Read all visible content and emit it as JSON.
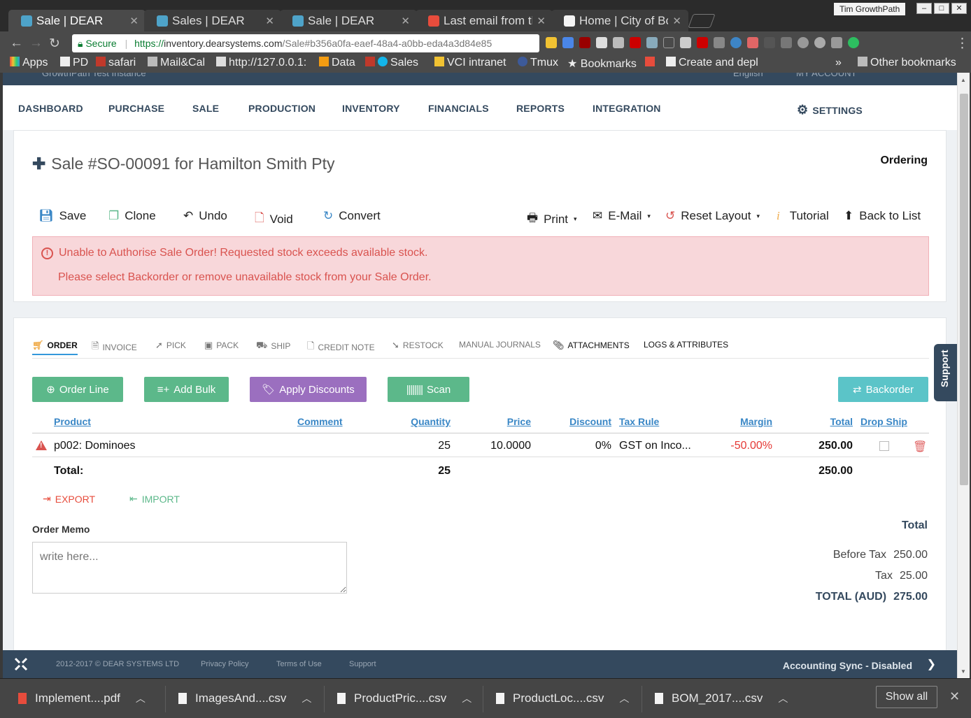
{
  "browser": {
    "tabs": [
      {
        "label": "Sale | DEAR",
        "active": true
      },
      {
        "label": "Sales | DEAR"
      },
      {
        "label": "Sale | DEAR"
      },
      {
        "label": "Last email from th"
      },
      {
        "label": "Home | City of Bor"
      }
    ],
    "user": "Tim GrowthPath",
    "url": {
      "secure_label": "Secure",
      "scheme": "https://",
      "host": "inventory.dearsystems.com",
      "path": "/Sale#b356a0fa-eaef-48a4-a0bb-eda4a3d84e85"
    },
    "bookmarks": [
      "Apps",
      "PD",
      "safari",
      "Mail&Cal",
      "http://127.0.0.1:",
      "Data",
      "Sales",
      "VCI intranet",
      "Tmux",
      "Bookmarks",
      "Create and depl",
      "Other bookmarks"
    ],
    "bookmarks_overflow": "»"
  },
  "topstrip": {
    "left_text": "GrowthPath Test Instance",
    "lang": "English",
    "account": "MY ACCOUNT"
  },
  "nav": {
    "items": [
      "DASHBOARD",
      "PURCHASE",
      "SALE",
      "PRODUCTION",
      "INVENTORY",
      "FINANCIALS",
      "REPORTS",
      "INTEGRATION"
    ],
    "settings": "SETTINGS"
  },
  "sale": {
    "title": "Sale #SO-00091 for Hamilton Smith Pty",
    "status": "Ordering",
    "actions_left": [
      "Save",
      "Clone",
      "Undo",
      "Void",
      "Convert"
    ],
    "actions_right": [
      "Print",
      "E-Mail",
      "Reset Layout",
      "Tutorial",
      "Back to List"
    ],
    "alert_line1": "Unable to Authorise Sale Order! Requested stock exceeds available stock.",
    "alert_line2": "Please select Backorder or remove unavailable stock from your Sale Order."
  },
  "subtabs": [
    "ORDER",
    "INVOICE",
    "PICK",
    "PACK",
    "SHIP",
    "CREDIT NOTE",
    "RESTOCK",
    "MANUAL JOURNALS",
    "ATTACHMENTS",
    "LOGS & ATTRIBUTES"
  ],
  "buttons": {
    "order_line": "Order Line",
    "add_bulk": "Add Bulk",
    "apply_discounts": "Apply Discounts",
    "scan": "Scan",
    "backorder": "Backorder"
  },
  "colors": {
    "green": "#5cb88a",
    "purple": "#9b6fbf",
    "teal": "#5bc4c8",
    "navy": "#34495e",
    "alert_red": "#d9534f"
  },
  "grid": {
    "headers": {
      "product": "Product",
      "comment": "Comment",
      "quantity": "Quantity",
      "price": "Price",
      "discount": "Discount",
      "tax_rule": "Tax Rule",
      "margin": "Margin",
      "total": "Total",
      "drop_ship": "Drop Ship"
    },
    "row": {
      "product": "p002: Dominoes",
      "quantity": "25",
      "price": "10.0000",
      "discount": "0%",
      "tax_rule": "GST on Inco...",
      "margin": "-50.00%",
      "total": "250.00"
    },
    "totals": {
      "label": "Total:",
      "quantity": "25",
      "total": "250.00"
    }
  },
  "export_label": "EXPORT",
  "import_label": "IMPORT",
  "memo": {
    "label": "Order Memo",
    "placeholder": "write here..."
  },
  "summary": {
    "heading": "Total",
    "before_tax_label": "Before Tax",
    "before_tax": "250.00",
    "tax_label": "Tax",
    "tax": "25.00",
    "total_label": "TOTAL (AUD)",
    "total": "275.00"
  },
  "footer": {
    "copyright": "2012-2017 © DEAR SYSTEMS LTD",
    "privacy": "Privacy Policy",
    "terms": "Terms of Use",
    "support": "Support",
    "sync": "Accounting Sync - Disabled"
  },
  "support_tab": "Support",
  "downloads": {
    "files": [
      "Implement....pdf",
      "ImagesAnd....csv",
      "ProductPric....csv",
      "ProductLoc....csv",
      "BOM_2017....csv"
    ],
    "show_all": "Show all"
  }
}
